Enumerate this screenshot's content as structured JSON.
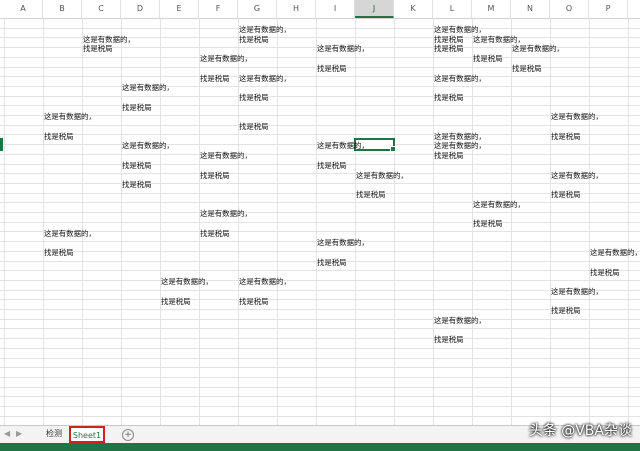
{
  "columns": [
    "A",
    "B",
    "C",
    "D",
    "E",
    "F",
    "G",
    "H",
    "I",
    "J",
    "K",
    "L",
    "M",
    "N",
    "O",
    "P"
  ],
  "selected_column": "J",
  "text_a": "这是有数据的，",
  "text_b": "找是税局",
  "cells": [
    {
      "col": "G",
      "row": 0,
      "t": "a"
    },
    {
      "col": "L",
      "row": 0,
      "t": "a"
    },
    {
      "col": "C",
      "row": 1,
      "t": "a"
    },
    {
      "col": "G",
      "row": 1,
      "t": "b"
    },
    {
      "col": "L",
      "row": 1,
      "t": "b"
    },
    {
      "col": "M",
      "row": 1,
      "t": "a"
    },
    {
      "col": "C",
      "row": 2,
      "t": "b"
    },
    {
      "col": "I",
      "row": 2,
      "t": "a"
    },
    {
      "col": "L",
      "row": 2,
      "t": "b"
    },
    {
      "col": "N",
      "row": 2,
      "t": "a"
    },
    {
      "col": "F",
      "row": 3,
      "t": "a"
    },
    {
      "col": "M",
      "row": 3,
      "t": "b"
    },
    {
      "col": "I",
      "row": 4,
      "t": "b"
    },
    {
      "col": "N",
      "row": 4,
      "t": "b"
    },
    {
      "col": "F",
      "row": 5,
      "t": "b"
    },
    {
      "col": "G",
      "row": 5,
      "t": "a"
    },
    {
      "col": "L",
      "row": 5,
      "t": "a"
    },
    {
      "col": "D",
      "row": 6,
      "t": "a"
    },
    {
      "col": "G",
      "row": 7,
      "t": "b"
    },
    {
      "col": "L",
      "row": 7,
      "t": "b"
    },
    {
      "col": "D",
      "row": 8,
      "t": "b"
    },
    {
      "col": "B",
      "row": 9,
      "t": "a"
    },
    {
      "col": "O",
      "row": 9,
      "t": "a"
    },
    {
      "col": "G",
      "row": 10,
      "t": "b"
    },
    {
      "col": "B",
      "row": 11,
      "t": "b"
    },
    {
      "col": "L",
      "row": 11,
      "t": "a"
    },
    {
      "col": "O",
      "row": 11,
      "t": "b"
    },
    {
      "col": "D",
      "row": 12,
      "t": "a"
    },
    {
      "col": "I",
      "row": 12,
      "t": "a"
    },
    {
      "col": "L",
      "row": 12,
      "t": "a"
    },
    {
      "col": "F",
      "row": 13,
      "t": "a"
    },
    {
      "col": "L",
      "row": 13,
      "t": "b"
    },
    {
      "col": "D",
      "row": 14,
      "t": "b"
    },
    {
      "col": "I",
      "row": 14,
      "t": "b"
    },
    {
      "col": "F",
      "row": 15,
      "t": "b"
    },
    {
      "col": "J",
      "row": 15,
      "t": "a"
    },
    {
      "col": "O",
      "row": 15,
      "t": "a"
    },
    {
      "col": "D",
      "row": 16,
      "t": "b"
    },
    {
      "col": "J",
      "row": 17,
      "t": "b"
    },
    {
      "col": "O",
      "row": 17,
      "t": "b"
    },
    {
      "col": "M",
      "row": 18,
      "t": "a"
    },
    {
      "col": "F",
      "row": 19,
      "t": "a"
    },
    {
      "col": "M",
      "row": 20,
      "t": "b"
    },
    {
      "col": "B",
      "row": 21,
      "t": "a"
    },
    {
      "col": "F",
      "row": 21,
      "t": "b"
    },
    {
      "col": "I",
      "row": 22,
      "t": "a"
    },
    {
      "col": "B",
      "row": 23,
      "t": "b"
    },
    {
      "col": "P",
      "row": 23,
      "t": "a"
    },
    {
      "col": "I",
      "row": 24,
      "t": "b"
    },
    {
      "col": "P",
      "row": 25,
      "t": "b"
    },
    {
      "col": "E",
      "row": 26,
      "t": "a"
    },
    {
      "col": "G",
      "row": 26,
      "t": "a"
    },
    {
      "col": "O",
      "row": 27,
      "t": "a"
    },
    {
      "col": "E",
      "row": 28,
      "t": "b"
    },
    {
      "col": "G",
      "row": 28,
      "t": "b"
    },
    {
      "col": "O",
      "row": 29,
      "t": "b"
    },
    {
      "col": "L",
      "row": 30,
      "t": "a"
    },
    {
      "col": "L",
      "row": 32,
      "t": "b"
    }
  ],
  "active_cell": {
    "col": "J",
    "row": 12
  },
  "tabs": [
    {
      "label": "检测",
      "active": false
    },
    {
      "label": "Sheet1",
      "active": true
    }
  ],
  "add_sheet_glyph": "⊕",
  "nav_prev": "◀",
  "nav_next": "▶",
  "watermark": "头条 @VBA杂谈",
  "colors": {
    "accent": "#217346",
    "tab_highlight": "#d32020"
  }
}
